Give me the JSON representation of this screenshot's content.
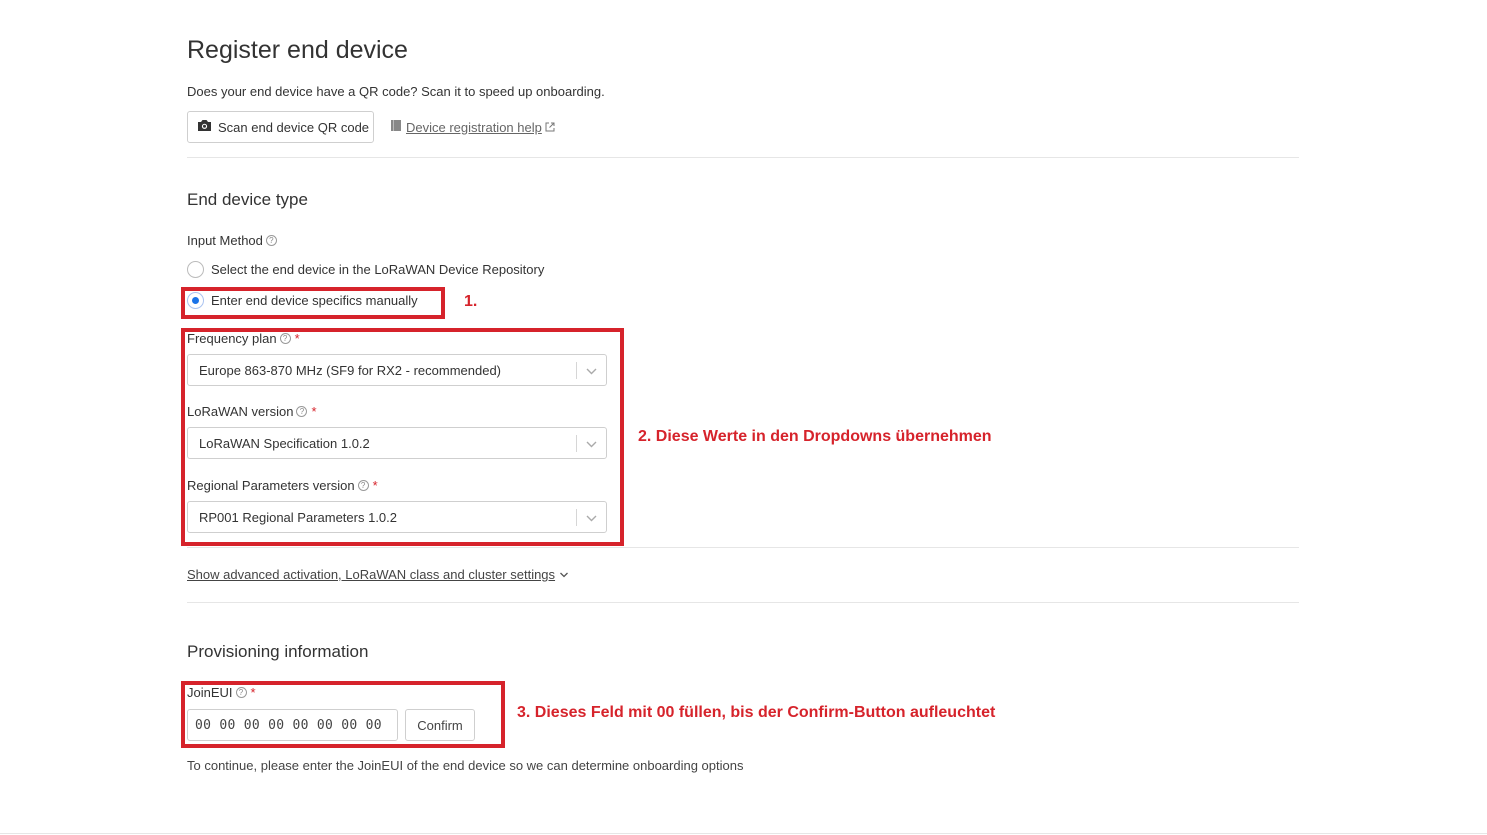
{
  "header": {
    "title": "Register end device",
    "subtitle": "Does your end device have a QR code? Scan it to speed up onboarding.",
    "scan_button": "Scan end device QR code",
    "help_link": "Device registration help"
  },
  "end_device_type": {
    "title": "End device type",
    "input_method_label": "Input Method",
    "options": [
      "Select the end device in the LoRaWAN Device Repository",
      "Enter end device specifics manually"
    ],
    "selected_option": "Enter end device specifics manually",
    "frequency_plan": {
      "label": "Frequency plan",
      "value": "Europe 863-870 MHz (SF9 for RX2 - recommended)"
    },
    "lorawan_version": {
      "label": "LoRaWAN version",
      "value": "LoRaWAN Specification 1.0.2"
    },
    "regional_parameters_version": {
      "label": "Regional Parameters version",
      "value": "RP001 Regional Parameters 1.0.2"
    },
    "advanced_link": "Show advanced activation, LoRaWAN class and cluster settings"
  },
  "provisioning": {
    "title": "Provisioning information",
    "join_eui_label": "JoinEUI",
    "join_eui_value": "00 00 00 00 00 00 00 00",
    "confirm_button": "Confirm",
    "hint": "To continue, please enter the JoinEUI of the end device so we can determine onboarding options"
  },
  "annotations": {
    "step1": "1.",
    "step2": "2. Diese Werte in den Dropdowns übernehmen",
    "step3": "3. Dieses Feld mit 00 füllen, bis der Confirm-Button aufleuchtet"
  },
  "colors": {
    "annotation_red": "#d6232b",
    "radio_selected": "#1a73e8"
  }
}
